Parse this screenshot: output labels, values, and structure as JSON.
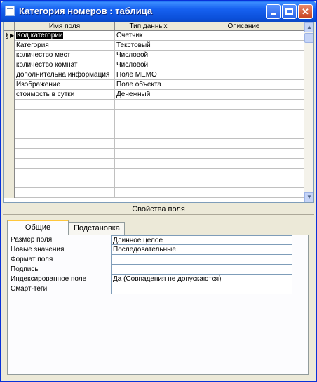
{
  "window": {
    "title": "Категория номеров : таблица"
  },
  "columns": {
    "field_name": "Имя поля",
    "data_type": "Тип данных",
    "description": "Описание"
  },
  "fields": [
    {
      "name": "Код категории",
      "type": "Счетчик",
      "description": ""
    },
    {
      "name": "Категория",
      "type": "Текстовый",
      "description": ""
    },
    {
      "name": "количество мест",
      "type": "Числовой",
      "description": ""
    },
    {
      "name": "количество комнат",
      "type": "Числовой",
      "description": ""
    },
    {
      "name": "дополнительна информация",
      "type": "Поле MEMO",
      "description": ""
    },
    {
      "name": "Изображение",
      "type": "Поле объекта",
      "description": ""
    },
    {
      "name": "стоимость в сутки",
      "type": "Денежный",
      "description": ""
    }
  ],
  "properties": {
    "title": "Свойства поля",
    "tabs": [
      "Общие",
      "Подстановка"
    ],
    "active_tab": "Общие",
    "rows": [
      {
        "label": "Размер поля",
        "value": "Длинное целое"
      },
      {
        "label": "Новые значения",
        "value": "Последовательные"
      },
      {
        "label": "Формат поля",
        "value": ""
      },
      {
        "label": "Подпись",
        "value": ""
      },
      {
        "label": "Индексированное поле",
        "value": "Да (Совпадения не допускаются)"
      },
      {
        "label": "Смарт-теги",
        "value": ""
      }
    ]
  },
  "icons": {
    "app": "table-icon",
    "minimize": "minimize-icon",
    "maximize": "maximize-icon",
    "close": "close-icon",
    "key": "primary-key-icon",
    "current_row": "current-row-arrow-icon",
    "scroll_up": "scroll-up-icon",
    "scroll_down": "scroll-down-icon"
  },
  "colors": {
    "titlebar": "#0b4fd9",
    "selection": "#000000",
    "active_tab_highlight": "#ffc73c"
  }
}
